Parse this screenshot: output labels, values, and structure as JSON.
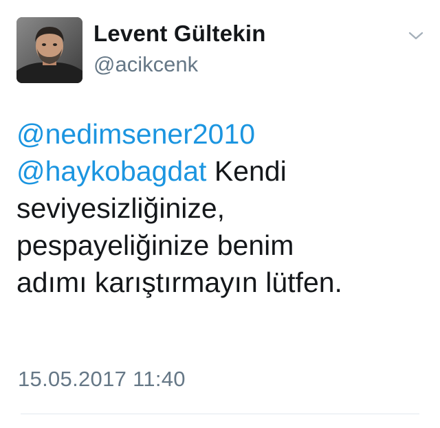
{
  "author": {
    "display_name": "Levent Gültekin",
    "handle": "@acikcenk",
    "avatar_icon": "profile-photo"
  },
  "menu": {
    "icon": "chevron-down-icon"
  },
  "tweet": {
    "mention_1": "@nedimsener2010",
    "mention_2": "@haykobagdat",
    "text_after_mentions": " Kendi",
    "line_3": "seviyesizliğinize,",
    "line_4": "pespayeliğinize benim",
    "line_5": "adımı karıştırmayın lütfen."
  },
  "timestamp": "15.05.2017 11:40",
  "colors": {
    "mention": "#1b95e0",
    "text": "#14171a",
    "secondary": "#657786",
    "divider": "#e1e8ed"
  }
}
